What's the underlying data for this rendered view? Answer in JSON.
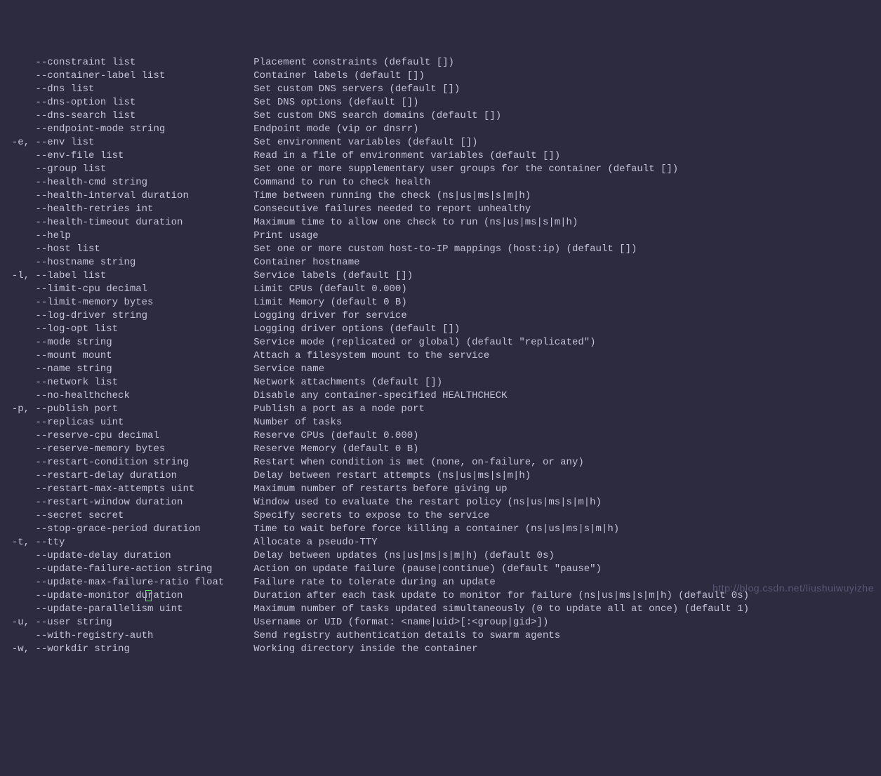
{
  "watermark": "http://blog.csdn.net/liushuiwuyizhe",
  "options": [
    {
      "short": "",
      "flag": "--constraint list",
      "desc": "Placement constraints (default [])"
    },
    {
      "short": "",
      "flag": "--container-label list",
      "desc": "Container labels (default [])"
    },
    {
      "short": "",
      "flag": "--dns list",
      "desc": "Set custom DNS servers (default [])"
    },
    {
      "short": "",
      "flag": "--dns-option list",
      "desc": "Set DNS options (default [])"
    },
    {
      "short": "",
      "flag": "--dns-search list",
      "desc": "Set custom DNS search domains (default [])"
    },
    {
      "short": "",
      "flag": "--endpoint-mode string",
      "desc": "Endpoint mode (vip or dnsrr)"
    },
    {
      "short": "-e,",
      "flag": "--env list",
      "desc": "Set environment variables (default [])"
    },
    {
      "short": "",
      "flag": "--env-file list",
      "desc": "Read in a file of environment variables (default [])"
    },
    {
      "short": "",
      "flag": "--group list",
      "desc": "Set one or more supplementary user groups for the container (default [])"
    },
    {
      "short": "",
      "flag": "--health-cmd string",
      "desc": "Command to run to check health"
    },
    {
      "short": "",
      "flag": "--health-interval duration",
      "desc": "Time between running the check (ns|us|ms|s|m|h)"
    },
    {
      "short": "",
      "flag": "--health-retries int",
      "desc": "Consecutive failures needed to report unhealthy"
    },
    {
      "short": "",
      "flag": "--health-timeout duration",
      "desc": "Maximum time to allow one check to run (ns|us|ms|s|m|h)"
    },
    {
      "short": "",
      "flag": "--help",
      "desc": "Print usage"
    },
    {
      "short": "",
      "flag": "--host list",
      "desc": "Set one or more custom host-to-IP mappings (host:ip) (default [])"
    },
    {
      "short": "",
      "flag": "--hostname string",
      "desc": "Container hostname"
    },
    {
      "short": "-l,",
      "flag": "--label list",
      "desc": "Service labels (default [])"
    },
    {
      "short": "",
      "flag": "--limit-cpu decimal",
      "desc": "Limit CPUs (default 0.000)"
    },
    {
      "short": "",
      "flag": "--limit-memory bytes",
      "desc": "Limit Memory (default 0 B)"
    },
    {
      "short": "",
      "flag": "--log-driver string",
      "desc": "Logging driver for service"
    },
    {
      "short": "",
      "flag": "--log-opt list",
      "desc": "Logging driver options (default [])"
    },
    {
      "short": "",
      "flag": "--mode string",
      "desc": "Service mode (replicated or global) (default \"replicated\")"
    },
    {
      "short": "",
      "flag": "--mount mount",
      "desc": "Attach a filesystem mount to the service"
    },
    {
      "short": "",
      "flag": "--name string",
      "desc": "Service name"
    },
    {
      "short": "",
      "flag": "--network list",
      "desc": "Network attachments (default [])"
    },
    {
      "short": "",
      "flag": "--no-healthcheck",
      "desc": "Disable any container-specified HEALTHCHECK"
    },
    {
      "short": "-p,",
      "flag": "--publish port",
      "desc": "Publish a port as a node port"
    },
    {
      "short": "",
      "flag": "--replicas uint",
      "desc": "Number of tasks"
    },
    {
      "short": "",
      "flag": "--reserve-cpu decimal",
      "desc": "Reserve CPUs (default 0.000)"
    },
    {
      "short": "",
      "flag": "--reserve-memory bytes",
      "desc": "Reserve Memory (default 0 B)"
    },
    {
      "short": "",
      "flag": "--restart-condition string",
      "desc": "Restart when condition is met (none, on-failure, or any)"
    },
    {
      "short": "",
      "flag": "--restart-delay duration",
      "desc": "Delay between restart attempts (ns|us|ms|s|m|h)"
    },
    {
      "short": "",
      "flag": "--restart-max-attempts uint",
      "desc": "Maximum number of restarts before giving up"
    },
    {
      "short": "",
      "flag": "--restart-window duration",
      "desc": "Window used to evaluate the restart policy (ns|us|ms|s|m|h)"
    },
    {
      "short": "",
      "flag": "--secret secret",
      "desc": "Specify secrets to expose to the service"
    },
    {
      "short": "",
      "flag": "--stop-grace-period duration",
      "desc": "Time to wait before force killing a container (ns|us|ms|s|m|h)"
    },
    {
      "short": "-t,",
      "flag": "--tty",
      "desc": "Allocate a pseudo-TTY"
    },
    {
      "short": "",
      "flag": "--update-delay duration",
      "desc": "Delay between updates (ns|us|ms|s|m|h) (default 0s)"
    },
    {
      "short": "",
      "flag": "--update-failure-action string",
      "desc": "Action on update failure (pause|continue) (default \"pause\")"
    },
    {
      "short": "",
      "flag": "--update-max-failure-ratio float",
      "desc": "Failure rate to tolerate during an update"
    },
    {
      "short": "",
      "flag": "--update-monitor duration",
      "desc": "Duration after each task update to monitor for failure (ns|us|ms|s|m|h) (default 0s)"
    },
    {
      "short": "",
      "flag": "--update-parallelism uint",
      "desc": "Maximum number of tasks updated simultaneously (0 to update all at once) (default 1)"
    },
    {
      "short": "-u,",
      "flag": "--user string",
      "desc": "Username or UID (format: <name|uid>[:<group|gid>])"
    },
    {
      "short": "",
      "flag": "--with-registry-auth",
      "desc": "Send registry authentication details to swarm agents"
    },
    {
      "short": "-w,",
      "flag": "--workdir string",
      "desc": "Working directory inside the container"
    }
  ]
}
